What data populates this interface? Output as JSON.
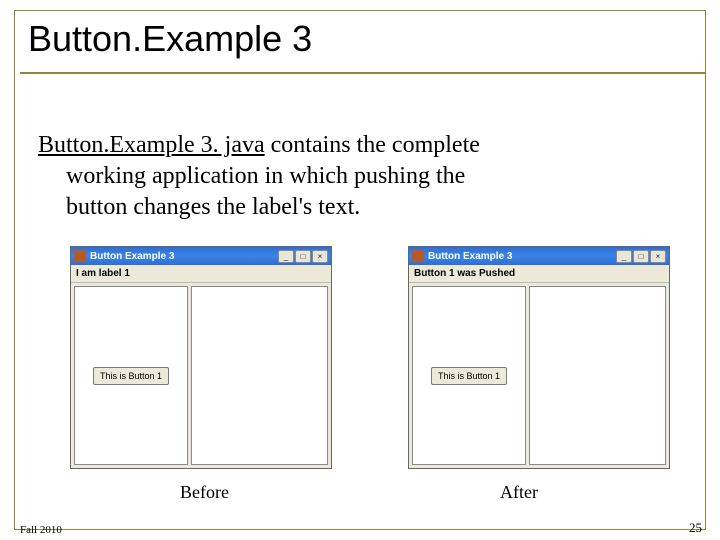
{
  "title": "Button.Example 3",
  "body": {
    "link_text": "Button.Example 3. java",
    "rest_line1": " contains the complete",
    "line2": "working application in which pushing the",
    "line3": "button changes the label's text."
  },
  "windows": {
    "before": {
      "title": "Button Example 3",
      "label": "I am label 1",
      "button": "This is Button 1"
    },
    "after": {
      "title": "Button Example 3",
      "label": "Button 1 was Pushed",
      "button": "This is Button 1"
    }
  },
  "window_controls": {
    "min": "_",
    "max": "□",
    "close": "×"
  },
  "captions": {
    "before": "Before",
    "after": "After"
  },
  "footer": {
    "left": "Fall 2010",
    "right": "25"
  }
}
